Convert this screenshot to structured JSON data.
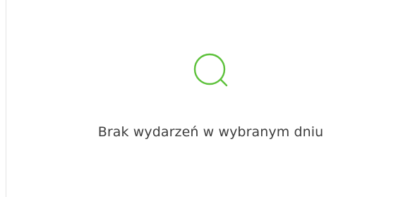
{
  "empty_state": {
    "icon": "search-icon",
    "accent_color": "#5cc13a",
    "message": "Brak wydarzeń w wybranym dniu"
  }
}
